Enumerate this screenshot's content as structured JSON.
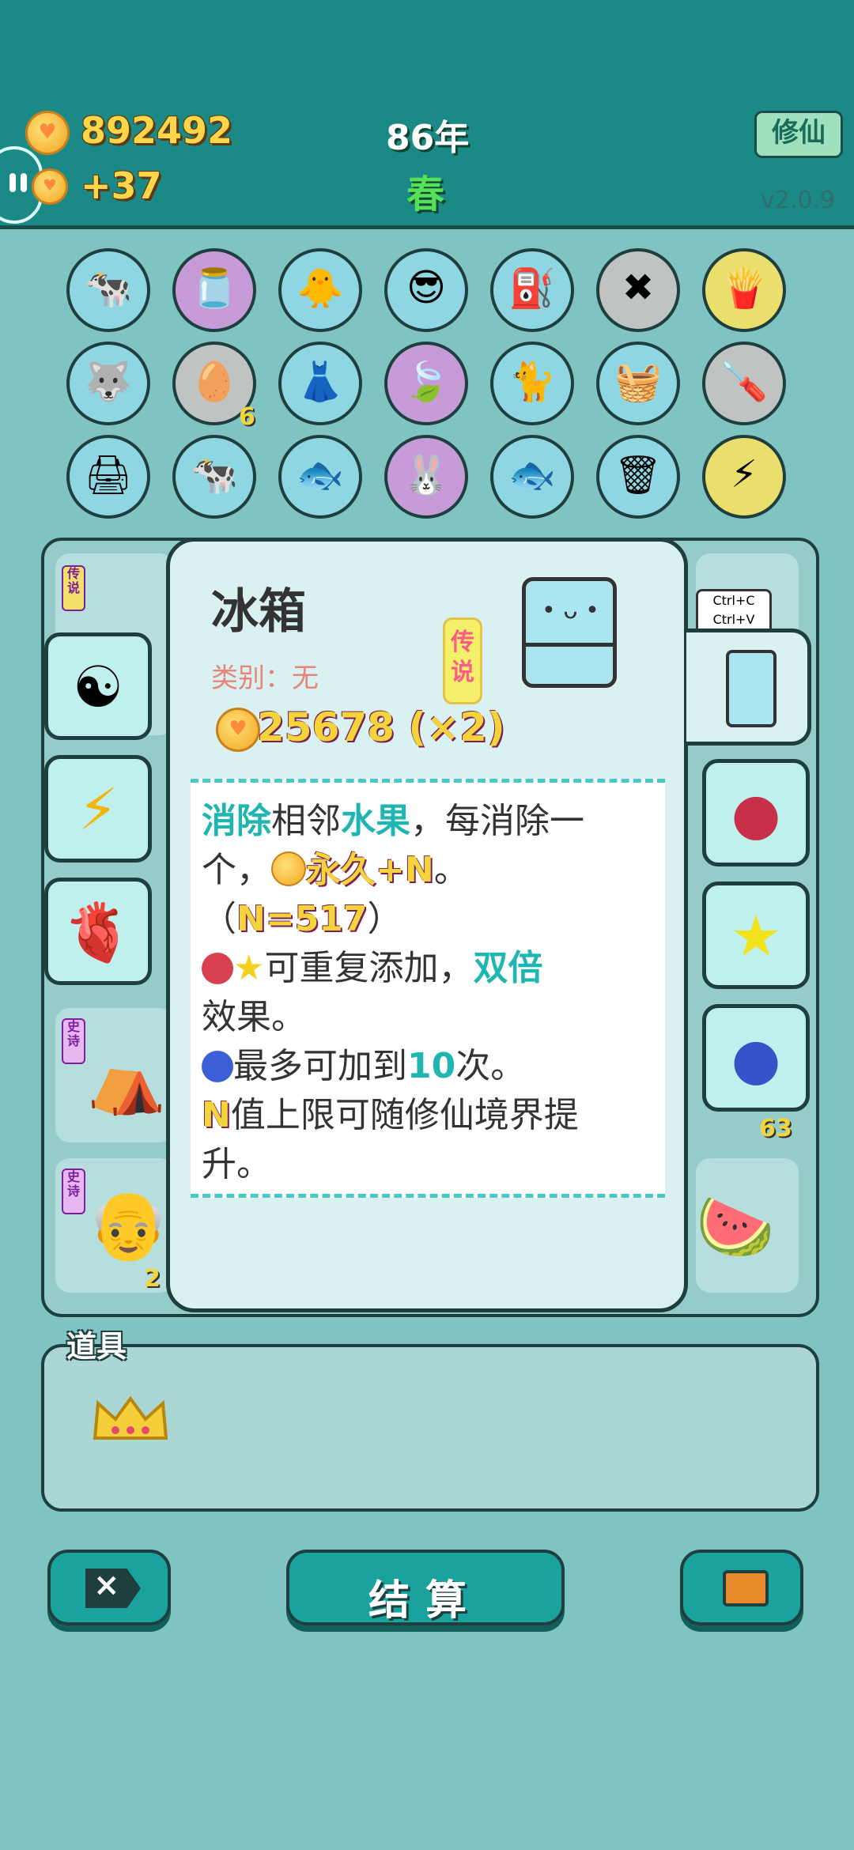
{
  "header": {
    "coins": "892492",
    "income": "+37",
    "year": "86年",
    "season": "春",
    "mode_button": "修仙",
    "version": "v2.0.9"
  },
  "top_items": [
    [
      "dual-cow-girl",
      "jam-jar",
      "chick-egg",
      "cool-cat",
      "air-pump",
      "delete-tag",
      "fries"
    ],
    [
      "husky",
      "egg-tray",
      "skirt",
      "leaf",
      "black-cat",
      "fruit-basket",
      "screwdriver"
    ],
    [
      "printer",
      "dual-cow-girl",
      "fishbowl",
      "bunny",
      "fishbowl",
      "trash-bag",
      "lightning"
    ]
  ],
  "top_counts": {
    "egg_tray": "6"
  },
  "inventory": {
    "tags": [
      "传说",
      "史诗",
      "史诗"
    ],
    "counts": [
      "2",
      "63",
      "2"
    ],
    "labels": [
      "Ctrl+C",
      "Ctrl+V"
    ]
  },
  "left_side_buttons": [
    "yin-yang-icon",
    "lightning-icon",
    "liver-icon"
  ],
  "right_side_buttons": [
    "lychee-icon",
    "star-fruit-icon",
    "blueberry-icon"
  ],
  "card": {
    "title": "冰箱",
    "category": "类别：无",
    "rarity": "传说",
    "price": "25678 (×2)",
    "desc": {
      "l1_a": "消除",
      "l1_b": "相邻",
      "l1_c": "水果",
      "l1_d": "，每消除一",
      "l2_a": "个，",
      "l2_b": "永久+N",
      "l2_c": "。",
      "l3_a": "（",
      "l3_b": "N=517",
      "l3_c": "）",
      "l4_a": "可重复添加，",
      "l4_b": "双倍",
      "l5": "效果。",
      "l6_a": "最多可加到",
      "l6_b": "10",
      "l6_c": "次。",
      "l7_a": "N",
      "l7_b": "值上限可随修仙境界提",
      "l8": "升。"
    }
  },
  "props": {
    "label": "道具",
    "items": [
      "crown-icon"
    ]
  },
  "bottom": {
    "settle": "结算"
  },
  "colors": {
    "topbar": "#1b8a86",
    "accent": "#1fb6b1",
    "gold": "#f4d43b"
  }
}
